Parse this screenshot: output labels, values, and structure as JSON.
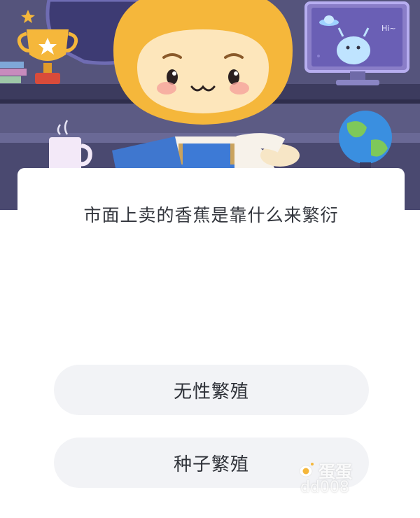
{
  "quiz": {
    "question": "市面上卖的香蕉是靠什么来繁衍",
    "options": [
      {
        "label": "无性繁殖"
      },
      {
        "label": "种子繁殖"
      }
    ]
  },
  "scene": {
    "monitor_speech": "Hi~"
  },
  "watermark": {
    "name": "蛋蛋",
    "sub": "dd008"
  },
  "colors": {
    "background": "#5c5b84",
    "mascot": "#f5b73b",
    "card": "#ffffff",
    "option_bg": "#f2f3f6",
    "question_text": "#33363d"
  }
}
